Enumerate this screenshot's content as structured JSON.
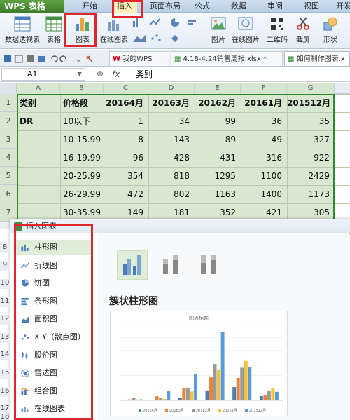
{
  "app": {
    "title": "WPS 表格"
  },
  "ribbon_tabs": [
    "开始",
    "插入",
    "页面布局",
    "公式",
    "数据",
    "审阅",
    "视图",
    "开发"
  ],
  "ribbon_buttons": {
    "pivot": "数据透视表",
    "table": "表格",
    "chart": "图表",
    "online_chart": "在线图表",
    "picture": "图片",
    "online_picture": "在线图片",
    "qrcode": "二维码",
    "screenshot": "截屏",
    "shape": "形状"
  },
  "doc_tabs": [
    "我的WPS",
    "4.18-4.24销售周报.xlsx *",
    "如何制作图表.x"
  ],
  "formula_bar": {
    "cell_ref": "A1",
    "fx": "fx",
    "value": "类别"
  },
  "grid": {
    "col_letters": [
      "A",
      "B",
      "C",
      "D",
      "E",
      "F",
      "G"
    ],
    "row_numbers": [
      "1",
      "2",
      "3",
      "4",
      "5",
      "6",
      "7"
    ],
    "hidden_row_numbers": [
      "8",
      "9",
      "10",
      "11",
      "12",
      "13",
      "14",
      "15",
      "16",
      "17",
      "18"
    ],
    "header": [
      "类别",
      "价格段",
      "20164月",
      "20163月",
      "20162月",
      "20161月",
      "201512月"
    ],
    "rows": [
      [
        "DR",
        "10以下",
        "1",
        "34",
        "99",
        "36",
        "35"
      ],
      [
        "",
        "10-15.99",
        "8",
        "143",
        "89",
        "49",
        "327"
      ],
      [
        "",
        "16-19.99",
        "96",
        "428",
        "431",
        "316",
        "922"
      ],
      [
        "",
        "20-25.99",
        "354",
        "818",
        "1295",
        "1100",
        "2429"
      ],
      [
        "",
        "26-29.99",
        "472",
        "802",
        "1163",
        "1400",
        "1173"
      ],
      [
        "",
        "30-35.99",
        "149",
        "181",
        "352",
        "421",
        "305"
      ]
    ]
  },
  "dialog": {
    "title": "插入图表",
    "nav": [
      "柱形图",
      "折线图",
      "饼图",
      "条形图",
      "面积图",
      "X Y（散点图）",
      "股价图",
      "雷达图",
      "组合图",
      "在线图表"
    ],
    "section_title": "簇状柱形图",
    "preview_title": "图表标题",
    "legend": [
      "20164月",
      "20163月",
      "20162月",
      "20161月",
      "201512月"
    ]
  },
  "colors": {
    "selection_fill": "#d8e8d0",
    "selection_border": "#2f8a2f",
    "highlight_red": "#e0262d",
    "ribbon_active": "#fbeeb8"
  }
}
